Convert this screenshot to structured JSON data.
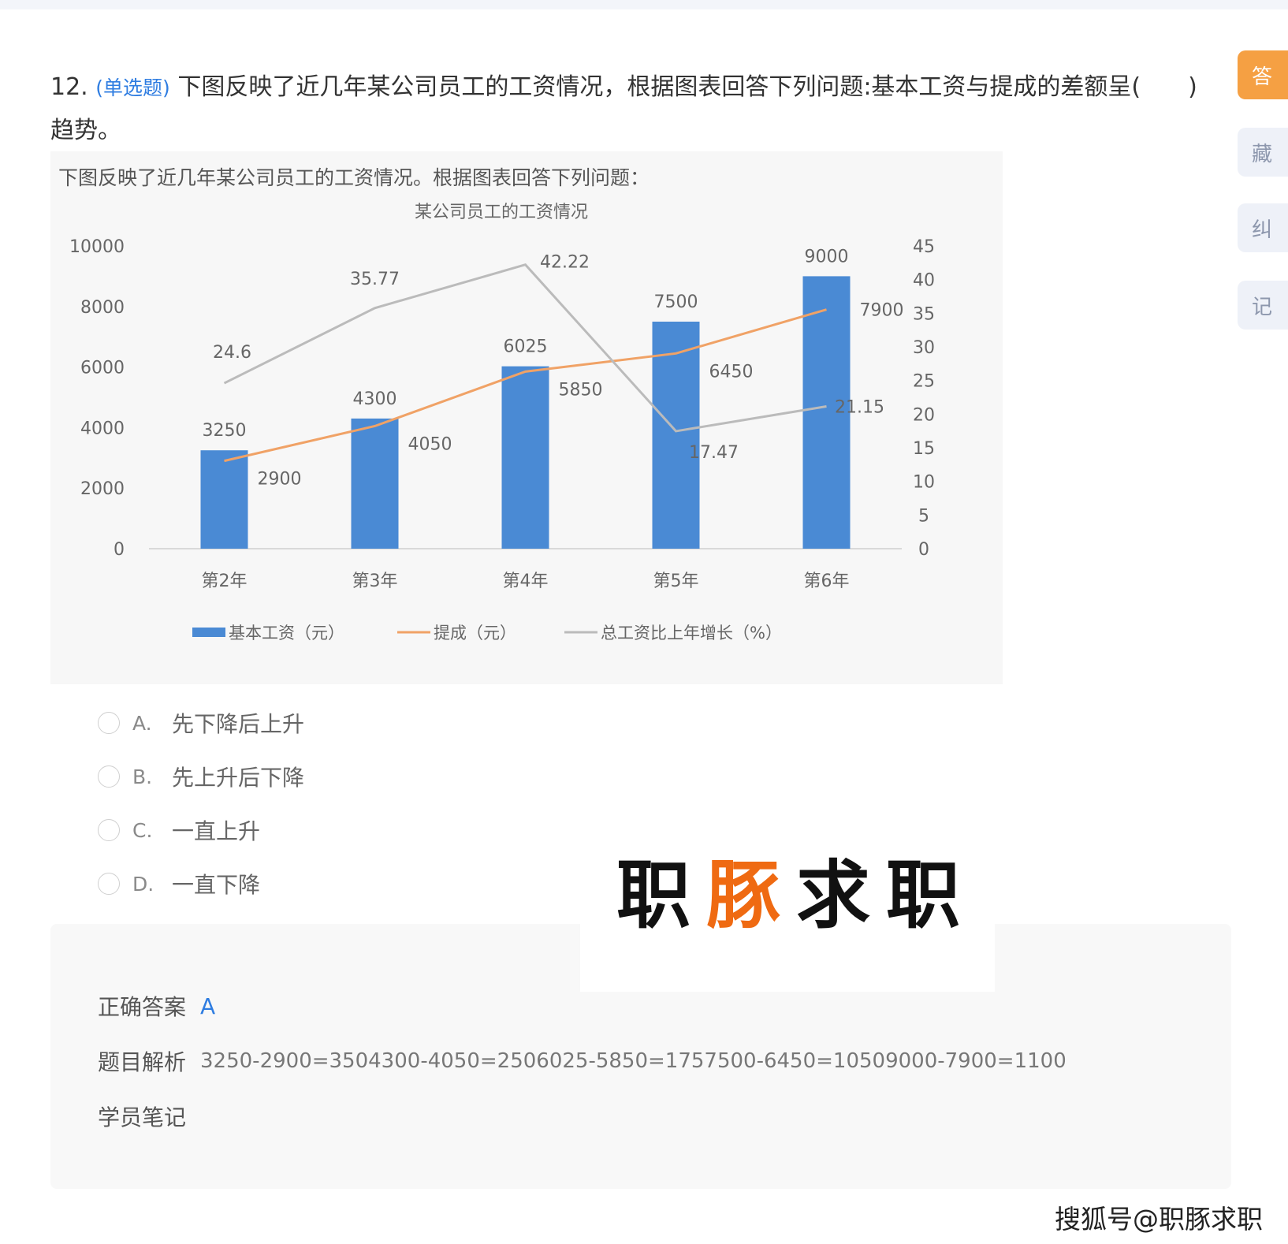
{
  "question": {
    "number": "12.",
    "type": "(单选题)",
    "text": "下图反映了近几年某公司员工的工资情况，根据图表回答下列问题:基本工资与提成的差额呈(　　) 趋势。"
  },
  "figure": {
    "intro": "下图反映了近几年某公司员工的工资情况。根据图表回答下列问题："
  },
  "chart_data": {
    "type": "bar",
    "title": "某公司员工的工资情况",
    "categories": [
      "第2年",
      "第3年",
      "第4年",
      "第5年",
      "第6年"
    ],
    "series": [
      {
        "name": "基本工资（元）",
        "type": "bar",
        "axis": "left",
        "values": [
          3250,
          4300,
          6025,
          7500,
          9000
        ],
        "color": "#4a8ad4"
      },
      {
        "name": "提成（元）",
        "type": "line",
        "axis": "left",
        "values": [
          2900,
          4050,
          5850,
          6450,
          7900
        ],
        "color": "#f0a266"
      },
      {
        "name": "总工资比上年增长（%）",
        "type": "line",
        "axis": "right",
        "values": [
          24.6,
          35.77,
          42.22,
          17.47,
          21.15
        ],
        "color": "#bbbbbb"
      }
    ],
    "y_left": {
      "min": 0,
      "max": 10000,
      "ticks": [
        "0",
        "2000",
        "4000",
        "6000",
        "8000",
        "10000"
      ]
    },
    "y_right": {
      "min": 0,
      "max": 45,
      "ticks": [
        "0",
        "5",
        "10",
        "15",
        "20",
        "25",
        "30",
        "35",
        "40",
        "45"
      ]
    },
    "legend_position": "bottom",
    "grid": false
  },
  "options": [
    {
      "key": "A.",
      "text": "先下降后上升"
    },
    {
      "key": "B.",
      "text": "先上升后下降"
    },
    {
      "key": "C.",
      "text": "一直上升"
    },
    {
      "key": "D.",
      "text": "一直下降"
    }
  ],
  "side_tabs": [
    {
      "label": "答",
      "active": true
    },
    {
      "label": "藏",
      "active": false
    },
    {
      "label": "纠",
      "active": false
    },
    {
      "label": "记",
      "active": false
    }
  ],
  "answer": {
    "correct_label": "正确答案",
    "correct_value": "A",
    "analysis_label": "题目解析",
    "analysis_text": "3250-2900=3504300-4050=2506025-5850=1757500-6450=10509000-7900=1100",
    "notes_label": "学员笔记"
  },
  "watermark": {
    "chars": [
      "职",
      "豚",
      "求",
      "职"
    ],
    "source": "搜狐号@职豚求职"
  }
}
